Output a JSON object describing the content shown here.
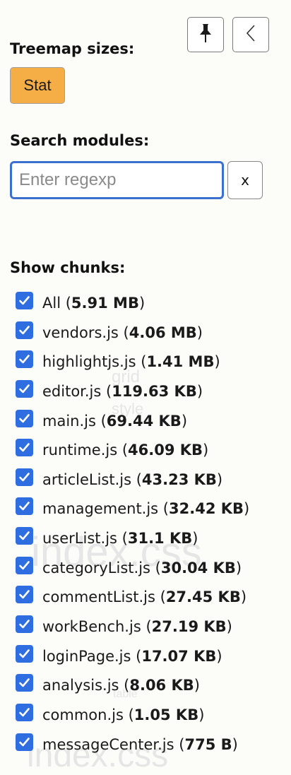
{
  "toolbar": {
    "pin_icon": "pushpin-icon",
    "collapse_icon": "chevron-left-icon"
  },
  "treemap_sizes": {
    "title": "Treemap sizes:",
    "options": [
      "Stat"
    ],
    "selected": "Stat",
    "active_color": "#f5ae45"
  },
  "search": {
    "title": "Search modules:",
    "placeholder": "Enter regexp",
    "value": "",
    "clear_label": "x",
    "focus_color": "#3b6fd0"
  },
  "chunks": {
    "title": "Show chunks:",
    "checkbox_color": "#2f6ee0",
    "items": [
      {
        "name": "All",
        "size": "5.91 MB",
        "checked": true
      },
      {
        "name": "vendors.js",
        "size": "4.06 MB",
        "checked": true
      },
      {
        "name": "highlightjs.js",
        "size": "1.41 MB",
        "checked": true
      },
      {
        "name": "editor.js",
        "size": "119.63 KB",
        "checked": true
      },
      {
        "name": "main.js",
        "size": "69.44 KB",
        "checked": true
      },
      {
        "name": "runtime.js",
        "size": "46.09 KB",
        "checked": true
      },
      {
        "name": "articleList.js",
        "size": "43.23 KB",
        "checked": true
      },
      {
        "name": "management.js",
        "size": "32.42 KB",
        "checked": true
      },
      {
        "name": "userList.js",
        "size": "31.1 KB",
        "checked": true
      },
      {
        "name": "categoryList.js",
        "size": "30.04 KB",
        "checked": true
      },
      {
        "name": "commentList.js",
        "size": "27.45 KB",
        "checked": true
      },
      {
        "name": "workBench.js",
        "size": "27.19 KB",
        "checked": true
      },
      {
        "name": "loginPage.js",
        "size": "17.07 KB",
        "checked": true
      },
      {
        "name": "analysis.js",
        "size": "8.06 KB",
        "checked": true
      },
      {
        "name": "common.js",
        "size": "1.05 KB",
        "checked": true
      },
      {
        "name": "messageCenter.js",
        "size": "775 B",
        "checked": true
      }
    ]
  },
  "background_labels": [
    "grid",
    "style",
    "index.css",
    "table",
    "index.css"
  ]
}
